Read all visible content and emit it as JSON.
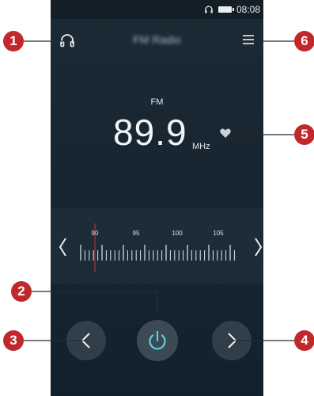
{
  "status_bar": {
    "time": "08:08",
    "icons": [
      "headset-icon",
      "battery-icon"
    ]
  },
  "app": {
    "title": "FM Radio"
  },
  "tuner": {
    "band": "FM",
    "frequency": "89.9",
    "unit": "MHz"
  },
  "dial": {
    "scale_labels": [
      "90",
      "95",
      "100",
      "105"
    ],
    "current_frequency": 89.9
  },
  "controls": {
    "headphone": "headphone-icon",
    "menu": "menu-icon",
    "favorite": "heart-icon",
    "prev": "chevron-left-icon",
    "power": "power-icon",
    "next": "chevron-right-icon"
  },
  "callouts": [
    "1",
    "2",
    "3",
    "4",
    "5",
    "6"
  ],
  "colors": {
    "callout": "#c1282c",
    "accent": "#5fd0e0",
    "screen_bg": "#172631"
  }
}
